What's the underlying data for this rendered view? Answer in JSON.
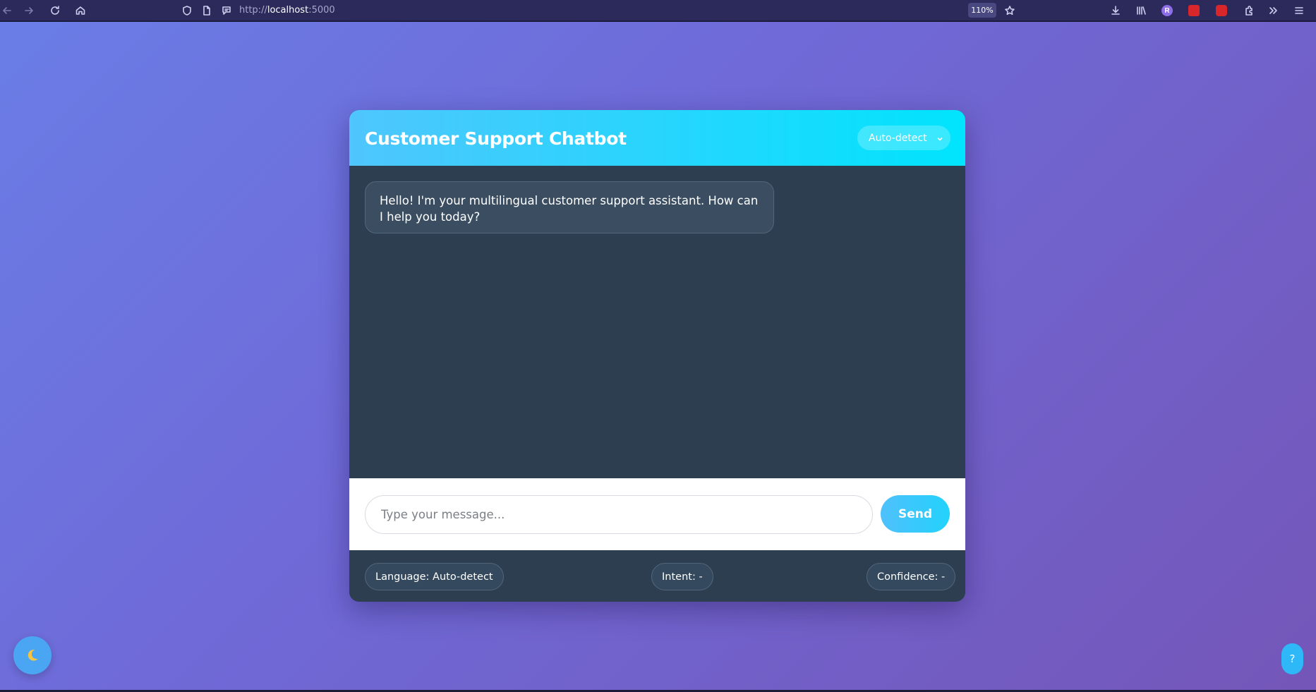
{
  "browser": {
    "url_scheme": "http://",
    "url_host": "localhost",
    "url_port": ":5000",
    "zoom": "110%",
    "profile_initial": "R"
  },
  "chat": {
    "title": "Customer Support Chatbot",
    "language_select": "Auto-detect",
    "messages": [
      {
        "sender": "bot",
        "text": "Hello! I'm your multilingual customer support assistant. How can I help you today?"
      }
    ],
    "input_placeholder": "Type your message...",
    "send_label": "Send"
  },
  "status": {
    "language": "Language: Auto-detect",
    "intent": "Intent: -",
    "confidence": "Confidence: -"
  },
  "floating": {
    "theme_icon": "moon-icon",
    "help_label": "?"
  },
  "colors": {
    "header_gradient_start": "#4fc6fd",
    "header_gradient_end": "#00e4fd",
    "chat_bg": "#2c3e50",
    "page_gradient_start": "#6a7de6",
    "page_gradient_end": "#7456b8",
    "send_button": "#23d2fc"
  }
}
